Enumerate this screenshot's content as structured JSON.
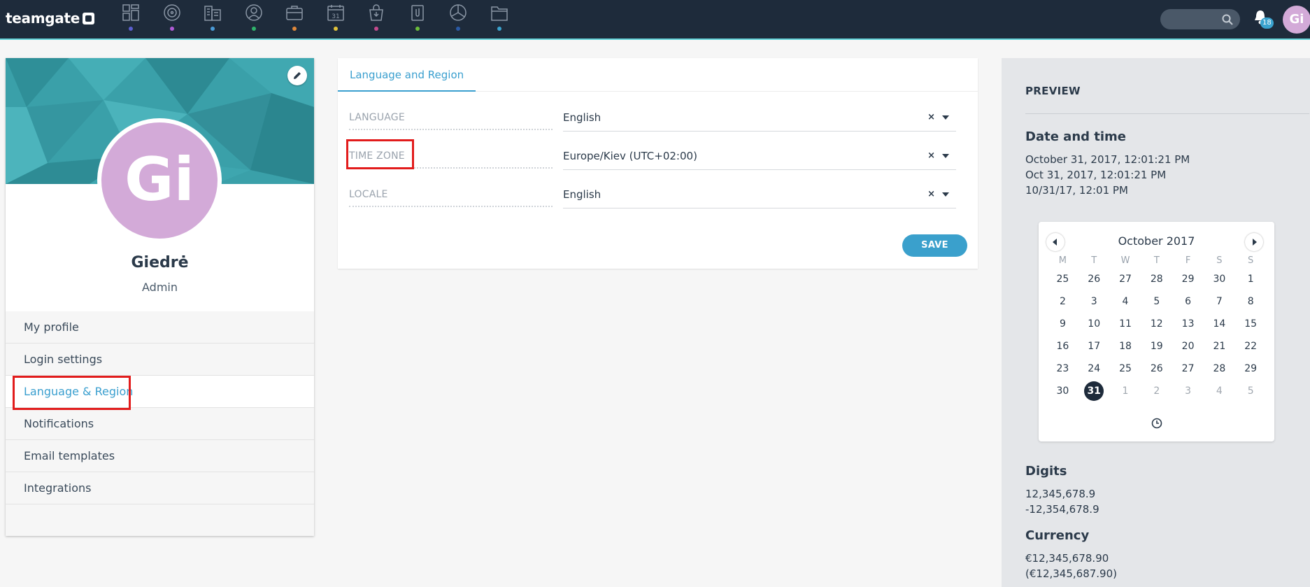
{
  "app": {
    "logo_text": "teamgate",
    "nav_icons": [
      {
        "icon": "dashboard-icon",
        "dot_color": "#5b5fcf"
      },
      {
        "icon": "target-icon",
        "dot_color": "#b05bd6"
      },
      {
        "icon": "companies-icon",
        "dot_color": "#4a9bd8"
      },
      {
        "icon": "contacts-icon",
        "dot_color": "#2fb36b"
      },
      {
        "icon": "deals-icon",
        "dot_color": "#e0883a"
      },
      {
        "icon": "calendar-icon",
        "dot_color": "#e1c23a"
      },
      {
        "icon": "inbox-icon",
        "dot_color": "#c44a8d"
      },
      {
        "icon": "documents-icon",
        "dot_color": "#6bbd3a"
      },
      {
        "icon": "reports-icon",
        "dot_color": "#2a5aa6"
      },
      {
        "icon": "files-icon",
        "dot_color": "#3aa3cf"
      }
    ],
    "notifications_count": "18",
    "user_initials": "Gi"
  },
  "profile": {
    "initials": "Gi",
    "name": "Giedrė",
    "role": "Admin",
    "menu": [
      {
        "label": "My profile"
      },
      {
        "label": "Login settings"
      },
      {
        "label": "Language & Region"
      },
      {
        "label": "Notifications"
      },
      {
        "label": "Email templates"
      },
      {
        "label": "Integrations"
      }
    ]
  },
  "settings": {
    "tab_label": "Language and Region",
    "rows": [
      {
        "label": "LANGUAGE",
        "value": "English"
      },
      {
        "label": "TIME ZONE",
        "value": "Europe/Kiev (UTC+02:00)"
      },
      {
        "label": "LOCALE",
        "value": "English"
      }
    ],
    "clear_symbol": "×",
    "save_label": "SAVE"
  },
  "preview": {
    "heading": "PREVIEW",
    "date_time_title": "Date and time",
    "date_lines": [
      "October 31, 2017, 12:01:21 PM",
      "Oct 31, 2017, 12:01:21 PM",
      "10/31/17, 12:01 PM"
    ],
    "calendar": {
      "title": "October 2017",
      "weekdays": [
        "M",
        "T",
        "W",
        "T",
        "F",
        "S",
        "S"
      ],
      "weeks": [
        [
          {
            "d": "25",
            "m": false
          },
          {
            "d": "26",
            "m": false
          },
          {
            "d": "27",
            "m": false
          },
          {
            "d": "28",
            "m": false
          },
          {
            "d": "29",
            "m": false
          },
          {
            "d": "30",
            "m": false
          },
          {
            "d": "1",
            "m": false
          }
        ],
        [
          {
            "d": "2",
            "m": false
          },
          {
            "d": "3",
            "m": false
          },
          {
            "d": "4",
            "m": false
          },
          {
            "d": "5",
            "m": false
          },
          {
            "d": "6",
            "m": false
          },
          {
            "d": "7",
            "m": false
          },
          {
            "d": "8",
            "m": false
          }
        ],
        [
          {
            "d": "9",
            "m": false
          },
          {
            "d": "10",
            "m": false
          },
          {
            "d": "11",
            "m": false
          },
          {
            "d": "12",
            "m": false
          },
          {
            "d": "13",
            "m": false
          },
          {
            "d": "14",
            "m": false
          },
          {
            "d": "15",
            "m": false
          }
        ],
        [
          {
            "d": "16",
            "m": false
          },
          {
            "d": "17",
            "m": false
          },
          {
            "d": "18",
            "m": false
          },
          {
            "d": "19",
            "m": false
          },
          {
            "d": "20",
            "m": false
          },
          {
            "d": "21",
            "m": false
          },
          {
            "d": "22",
            "m": false
          }
        ],
        [
          {
            "d": "23",
            "m": false
          },
          {
            "d": "24",
            "m": false
          },
          {
            "d": "25",
            "m": false
          },
          {
            "d": "26",
            "m": false
          },
          {
            "d": "27",
            "m": false
          },
          {
            "d": "28",
            "m": false
          },
          {
            "d": "29",
            "m": false
          }
        ],
        [
          {
            "d": "30",
            "m": false
          },
          {
            "d": "31",
            "m": false,
            "today": true
          },
          {
            "d": "1",
            "m": true
          },
          {
            "d": "2",
            "m": true
          },
          {
            "d": "3",
            "m": true
          },
          {
            "d": "4",
            "m": true
          },
          {
            "d": "5",
            "m": true
          }
        ]
      ]
    },
    "digits_title": "Digits",
    "digits_lines": [
      "12,345,678.9",
      "-12,354,678.9"
    ],
    "currency_title": "Currency",
    "currency_lines": [
      "€12,345,678.90",
      "(€12,345,687.90)"
    ]
  }
}
